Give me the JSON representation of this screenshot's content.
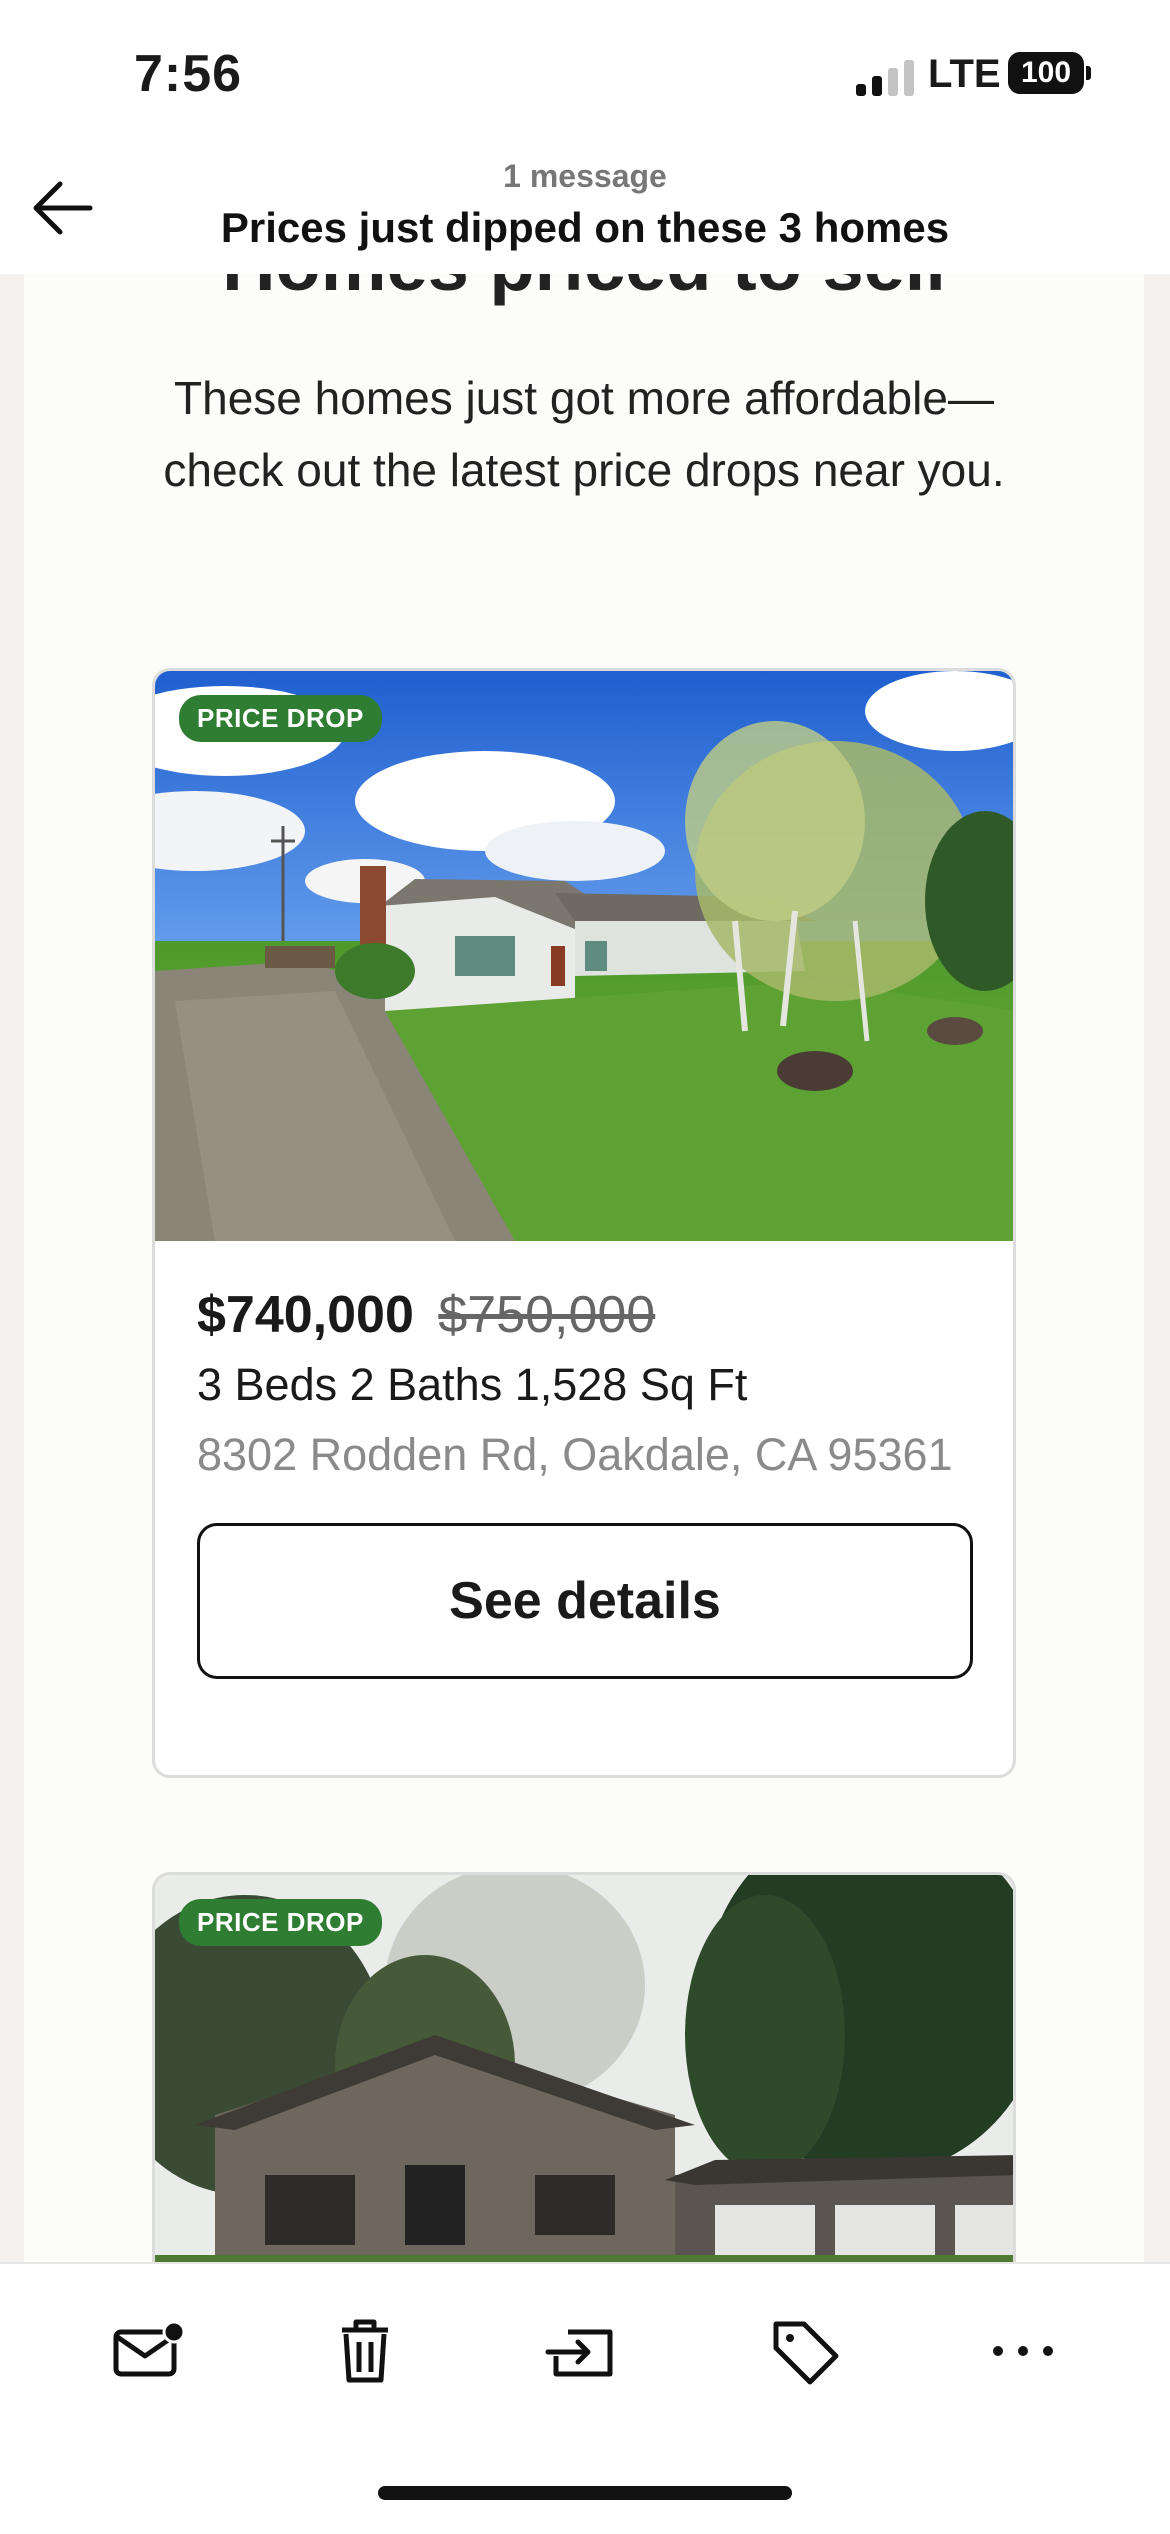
{
  "status_bar": {
    "time": "7:56",
    "network": "LTE",
    "battery": "100"
  },
  "header": {
    "message_count": "1 message",
    "subject": "Prices just dipped on these 3 homes",
    "back_icon": "arrow-left-icon"
  },
  "email": {
    "heading": "Homes priced to sell",
    "intro": "These homes just got more affordable—check out the latest price drops near you.",
    "listings": [
      {
        "badge": "PRICE DROP",
        "price": "$740,000",
        "old_price": "$750,000",
        "specs": "3 Beds 2 Baths 1,528 Sq Ft",
        "address": "8302 Rodden Rd, Oakdale, CA 95361",
        "button": "See details"
      },
      {
        "badge": "PRICE DROP"
      }
    ]
  },
  "toolbar": {
    "icons": [
      "mark-unread-icon",
      "trash-icon",
      "move-to-folder-icon",
      "label-tag-icon",
      "more-icon"
    ]
  },
  "colors": {
    "badge_green": "#2e7d32",
    "page_bg": "#f3f0ed"
  }
}
